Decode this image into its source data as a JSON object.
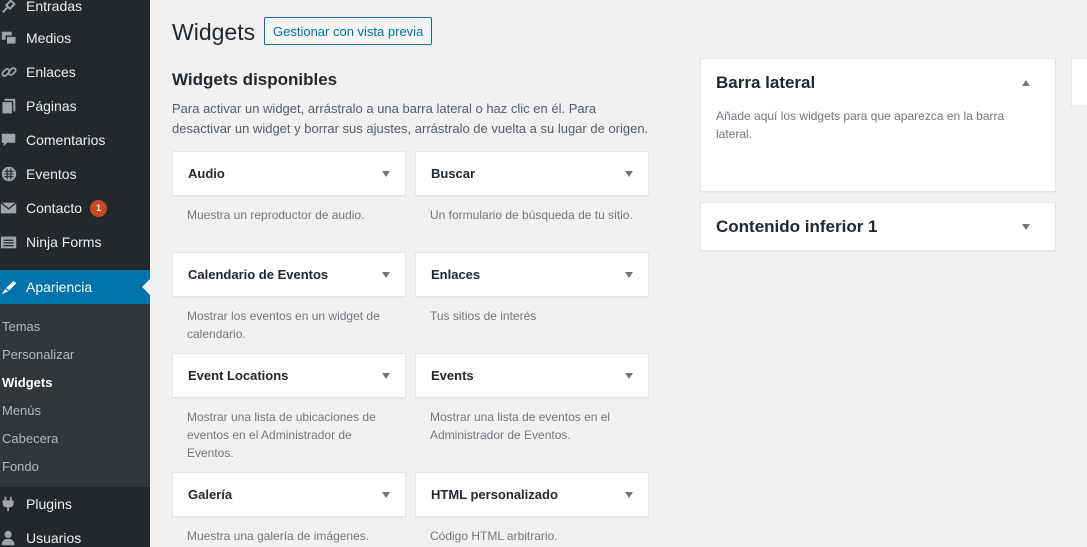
{
  "sidebar": {
    "items": [
      {
        "label": "Entradas",
        "icon": "pin-icon"
      },
      {
        "label": "Medios",
        "icon": "media-icon"
      },
      {
        "label": "Enlaces",
        "icon": "link-icon"
      },
      {
        "label": "Páginas",
        "icon": "pages-icon"
      },
      {
        "label": "Comentarios",
        "icon": "comment-icon"
      },
      {
        "label": "Eventos",
        "icon": "calendar-icon"
      },
      {
        "label": "Contacto",
        "icon": "mail-icon",
        "badge": "1"
      },
      {
        "label": "Ninja Forms",
        "icon": "forms-icon"
      }
    ],
    "active": {
      "label": "Apariencia",
      "icon": "brush-icon"
    },
    "submenu": [
      "Temas",
      "Personalizar",
      "Widgets",
      "Menús",
      "Cabecera",
      "Fondo"
    ],
    "submenu_current": "Widgets",
    "bottom_items": [
      {
        "label": "Plugins",
        "icon": "plugin-icon"
      },
      {
        "label": "Usuarios",
        "icon": "users-icon"
      }
    ]
  },
  "page": {
    "title": "Widgets",
    "preview_button": "Gestionar con vista previa",
    "available_title": "Widgets disponibles",
    "available_desc": "Para activar un widget, arrástralo a una barra lateral o haz clic en él. Para desactivar un widget y borrar sus ajustes, arrástralo de vuelta a su lugar de origen."
  },
  "widgets": [
    {
      "title": "Audio",
      "desc": "Muestra un reproductor de audio."
    },
    {
      "title": "Buscar",
      "desc": "Un formulario de búsqueda de tu sitio."
    },
    {
      "title": "Calendario de Eventos",
      "desc": "Mostrar los eventos en un widget de calendario."
    },
    {
      "title": "Enlaces",
      "desc": "Tus sitios de interés"
    },
    {
      "title": "Event Locations",
      "desc": "Mostrar una lista de ubicaciones de eventos en el Administrador de Eventos."
    },
    {
      "title": "Events",
      "desc": "Mostrar una lista de eventos en el Administrador de Eventos."
    },
    {
      "title": "Galería",
      "desc": "Muestra una galería de imágenes."
    },
    {
      "title": "HTML personalizado",
      "desc": "Código HTML arbitrario."
    }
  ],
  "areas": [
    {
      "title": "Barra lateral",
      "desc": "Añade aquí los widgets para que aparezca en la barra lateral.",
      "expanded": true
    },
    {
      "title": "Contenido inferior 1",
      "desc": "",
      "expanded": false
    }
  ],
  "colors": {
    "sidebar_bg": "#23282d",
    "active_bg": "#0073aa",
    "badge": "#ca4a1f",
    "link": "#0071a1"
  }
}
